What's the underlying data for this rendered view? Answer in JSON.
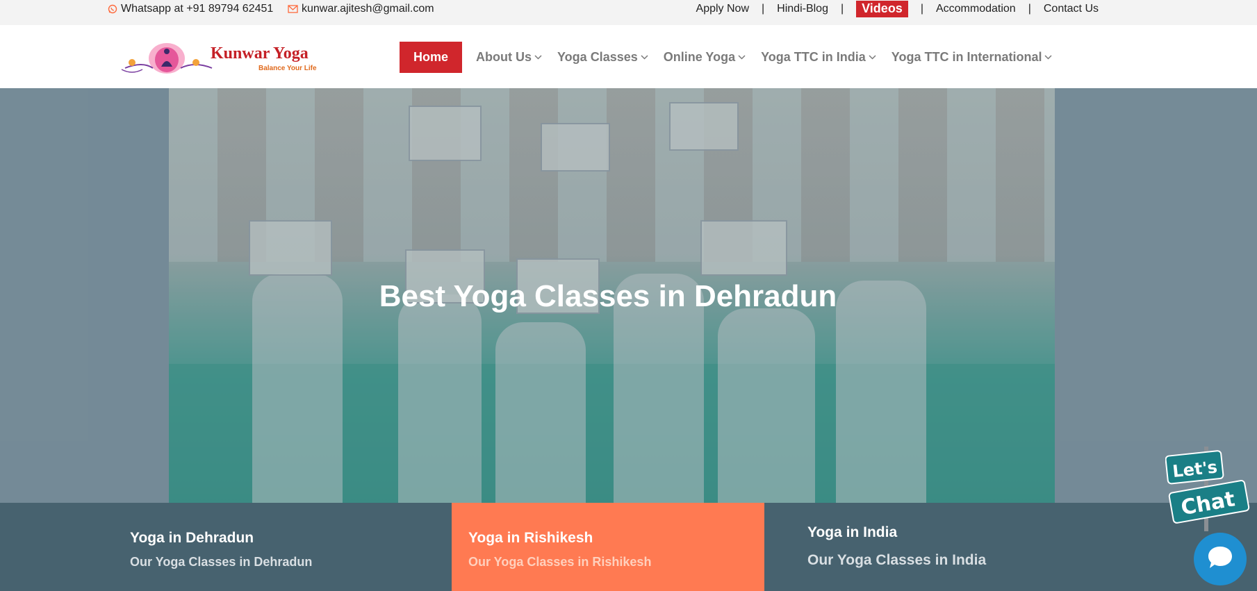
{
  "topbar": {
    "whatsapp": "Whatsapp at +91 89794 62451",
    "email": "kunwar.ajitesh@gmail.com",
    "links": [
      "Apply Now",
      "Hindi-Blog",
      "Videos",
      "Accommodation",
      "Contact Us"
    ],
    "separator": "|"
  },
  "brand": {
    "name": "Kunwar Yoga",
    "tagline": "Balance Your Life"
  },
  "nav": {
    "home": "Home",
    "items": [
      "About Us",
      "Yoga Classes",
      "Online Yoga",
      "Yoga TTC in India",
      "Yoga TTC in International"
    ]
  },
  "hero": {
    "title": "Best Yoga Classes in Dehradun"
  },
  "boxes": [
    {
      "title": "Yoga in Dehradun",
      "subtitle": "Our Yoga Classes in Dehradun"
    },
    {
      "title": "Yoga in Rishikesh",
      "subtitle": "Our Yoga Classes in Rishikesh"
    },
    {
      "title": "Yoga in India",
      "subtitle": "Our Yoga Classes in India"
    }
  ],
  "chat": {
    "sign_line1": "Let's",
    "sign_line2": "Chat"
  },
  "colors": {
    "accent": "#d0262c",
    "orange": "#ff7a52",
    "strip": "#47626f",
    "chat": "#1f8fd1"
  },
  "icons": {
    "whatsapp": "whatsapp-icon",
    "email": "envelope-icon",
    "chevron": "chevron-down-icon"
  }
}
